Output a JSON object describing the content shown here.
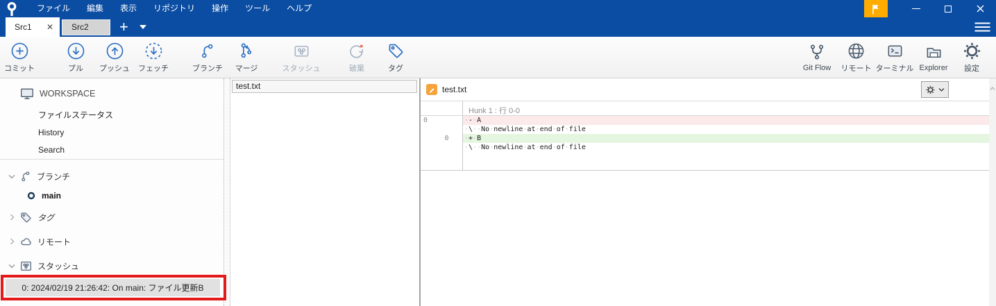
{
  "colors": {
    "chrome_blue": "#0b4da2",
    "flag_orange": "#ffab00",
    "icon_blue": "#2a6fc4",
    "icon_disabled": "#a7b4c4",
    "icon_slate": "#4a5a6c",
    "removed_bg": "#fce9e9",
    "added_bg": "#e5f6e0",
    "annotation_red": "#e41a1a"
  },
  "menubar": {
    "items": [
      "ファイル",
      "編集",
      "表示",
      "リポジトリ",
      "操作",
      "ツール",
      "ヘルプ"
    ]
  },
  "tabs": {
    "active_label": "Src1",
    "close_glyph": "✕",
    "inactive_label": "Src2",
    "add_glyph": "+"
  },
  "toolbar": {
    "commit": "コミット",
    "pull": "プル",
    "push": "プッシュ",
    "fetch": "フェッチ",
    "branch": "ブランチ",
    "merge": "マージ",
    "stash": "スタッシュ",
    "discard": "破棄",
    "tag": "タグ",
    "gitflow": "Git Flow",
    "remote": "リモート",
    "terminal": "ターミナル",
    "explorer": "Explorer",
    "settings": "設定"
  },
  "sidebar": {
    "workspace": "WORKSPACE",
    "file_status": "ファイルステータス",
    "history": "History",
    "search": "Search",
    "branches_label": "ブランチ",
    "main_branch": "main",
    "tags_label": "タグ",
    "remotes_label": "リモート",
    "stashes_label": "スタッシュ",
    "stash_item": "0: 2024/02/19 21:26:42: On main: ファイル更新B"
  },
  "file_list": {
    "file1": "test.txt"
  },
  "diff": {
    "file_name": "test.txt",
    "hunk_header": "Hunk 1 : 行 0-0",
    "lines": [
      {
        "old": "0",
        "new": "",
        "text": " - A",
        "type": "removed"
      },
      {
        "old": "",
        "new": "",
        "text": " \\  No newline at end of file",
        "type": "context"
      },
      {
        "old": "",
        "new": "0",
        "text": " + B",
        "type": "added"
      },
      {
        "old": "",
        "new": "",
        "text": " \\  No newline at end of file",
        "type": "context"
      }
    ]
  }
}
